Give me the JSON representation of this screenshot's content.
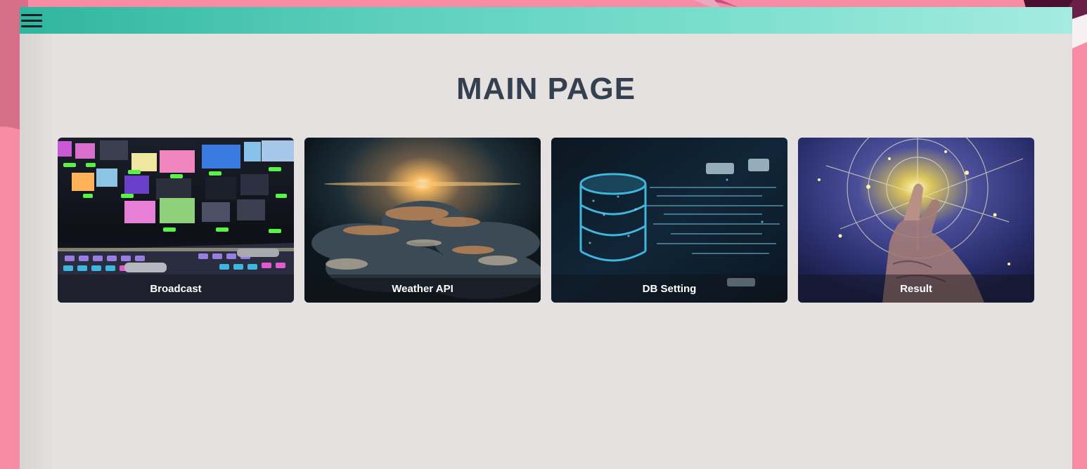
{
  "page": {
    "title": "MAIN PAGE"
  },
  "topbar": {
    "menu_icon": "hamburger-menu-icon"
  },
  "cards": [
    {
      "label": "Broadcast"
    },
    {
      "label": "Weather API"
    },
    {
      "label": "DB Setting"
    },
    {
      "label": "Result"
    }
  ],
  "colors": {
    "background": "#f68ba3",
    "panel": "#e4e1e0",
    "topbar_start": "#2fb5a0",
    "topbar_end": "#a5ebe0",
    "title": "#34404f"
  }
}
